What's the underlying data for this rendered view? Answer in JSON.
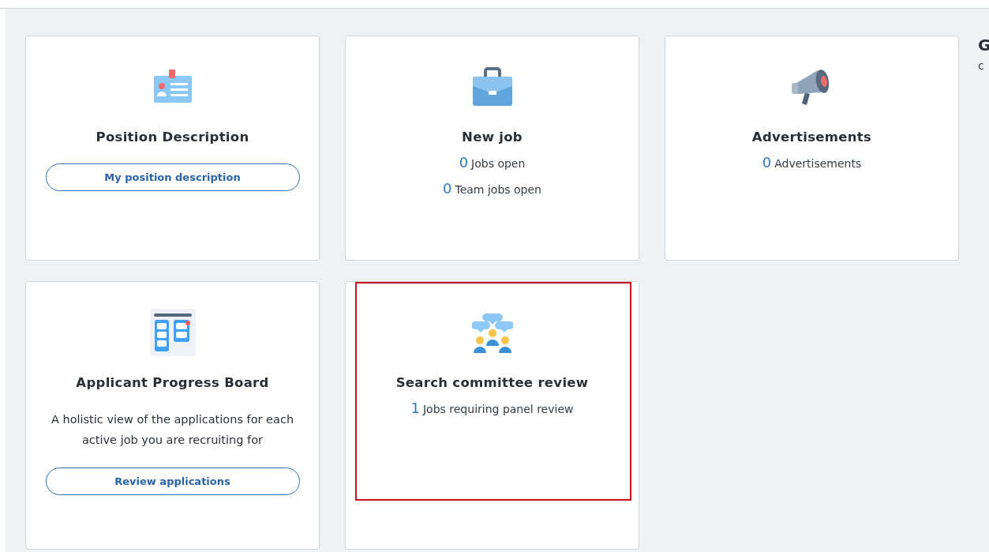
{
  "cards": [
    {
      "title": "Position Description",
      "button": "My position description",
      "highlighted": false
    },
    {
      "title": "New job",
      "stats": [
        {
          "count": "0",
          "label": "Jobs open"
        },
        {
          "count": "0",
          "label": "Team jobs open"
        }
      ],
      "highlighted": false
    },
    {
      "title": "Advertisements",
      "stats": [
        {
          "count": "0",
          "label": "Advertisements"
        }
      ],
      "highlighted": false
    },
    {
      "title": "Applicant Progress Board",
      "description": "A holistic view of the applications for each active job you are recruiting for",
      "button": "Review applications",
      "highlighted": false
    },
    {
      "title": "Search committee review",
      "stats": [
        {
          "count": "1",
          "label": "Jobs requiring panel review"
        }
      ],
      "highlighted": true
    }
  ],
  "side_panel": {
    "heading": "G",
    "text": "c"
  }
}
